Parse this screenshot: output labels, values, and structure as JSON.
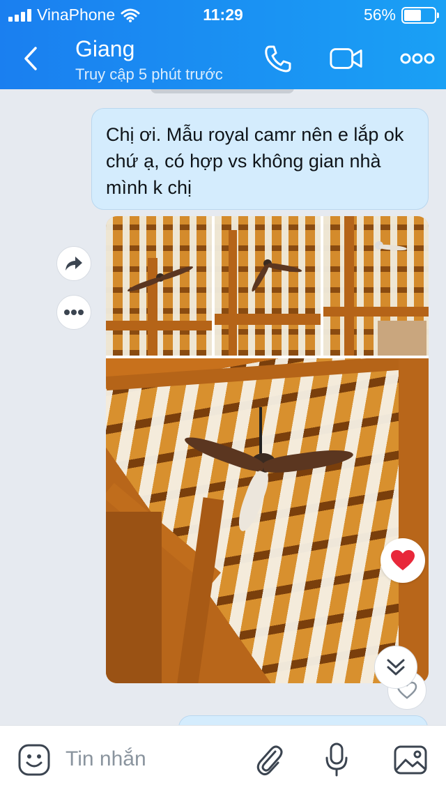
{
  "status_bar": {
    "carrier": "VinaPhone",
    "time": "11:29",
    "battery_percent": "56%",
    "battery_level": 0.56
  },
  "header": {
    "name": "Giang",
    "status": "Truy cập 5 phút trước",
    "icons": [
      "back-chevron-icon",
      "phone-icon",
      "video-camera-icon",
      "more-icon"
    ]
  },
  "messages": [
    {
      "type": "text",
      "text": "Chị ơi. Mẫu royal camr nên e lắp ok chứ ạ, có hợp vs không gian nhà mình k chị"
    },
    {
      "type": "photos",
      "count": 4,
      "side_icons": [
        "share-arrow-icon",
        "more-options-icon"
      ],
      "reaction": "heart-icon"
    }
  ],
  "input_bar": {
    "placeholder": "Tin nhắn",
    "icons": [
      "sticker-icon",
      "attach-icon",
      "microphone-icon",
      "image-icon"
    ]
  },
  "colors": {
    "header": "#1a8ff2",
    "bubble": "#d4ecfd",
    "heart": "#e8283a"
  }
}
